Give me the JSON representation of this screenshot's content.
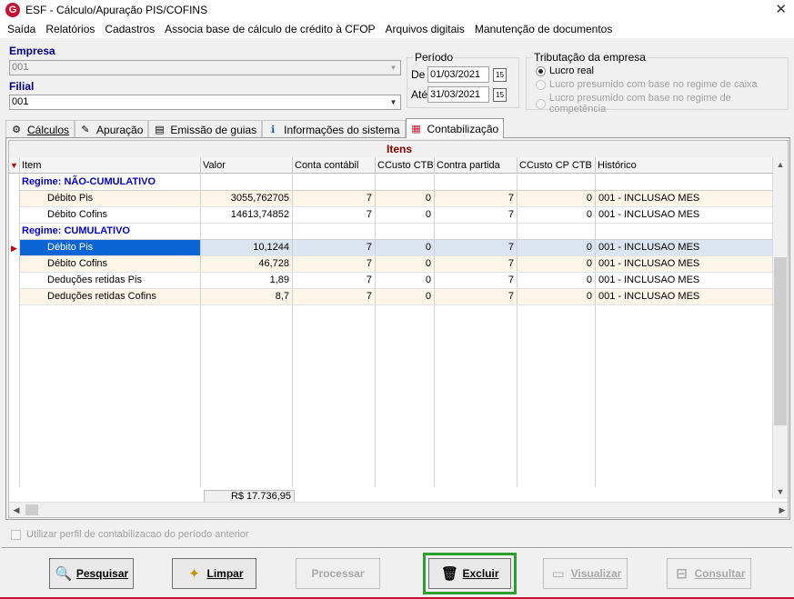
{
  "window": {
    "title": "ESF - Cálculo/Apuração PIS/COFINS",
    "logo_letter": "G",
    "close_glyph": "✕"
  },
  "menu": [
    "Saída",
    "Relatórios",
    "Cadastros",
    "Associa base de cálculo de crédito à CFOP",
    "Arquivos digitais",
    "Manutenção de documentos"
  ],
  "empresa": {
    "label": "Empresa",
    "value": "001"
  },
  "filial": {
    "label": "Filial",
    "value": "001"
  },
  "periodo": {
    "label": "Período",
    "de_label": "De",
    "de_value": "01/03/2021",
    "ate_label": "Até",
    "ate_value": "31/03/2021",
    "cal_glyph": "15"
  },
  "tributacao": {
    "label": "Tributação da empresa",
    "options": [
      {
        "label": "Lucro real",
        "checked": true,
        "enabled": true
      },
      {
        "label": "Lucro presumido com base no regime de caixa",
        "checked": false,
        "enabled": false
      },
      {
        "label": "Lucro presumido com base no regime de competência",
        "checked": false,
        "enabled": false
      }
    ]
  },
  "tabs": [
    {
      "label": "Cálculos",
      "icon": "calc-icon"
    },
    {
      "label": "Apuração",
      "icon": "apuracao-icon"
    },
    {
      "label": "Emissão de guias",
      "icon": "document-icon"
    },
    {
      "label": "Informações do sistema",
      "icon": "info-icon"
    },
    {
      "label": "Contabilização",
      "icon": "calendar-icon",
      "active": true
    }
  ],
  "grid": {
    "title": "Itens",
    "columns": [
      "Item",
      "Valor",
      "Conta contábil",
      "CCusto CTB",
      "Contra partida",
      "CCusto CP CTB",
      "Histórico"
    ],
    "rows": [
      {
        "type": "group",
        "item": "Regime: NÃO-CUMULATIVO"
      },
      {
        "type": "data",
        "item": "Débito Pis",
        "valor": "3055,762705",
        "conta": "7",
        "ccusto": "0",
        "contra": "7",
        "ccustocp": "0",
        "historico": "001 - INCLUSAO MES"
      },
      {
        "type": "data",
        "item": "Débito Cofins",
        "valor": "14613,74852",
        "conta": "7",
        "ccusto": "0",
        "contra": "7",
        "ccustocp": "0",
        "historico": "001 - INCLUSAO MES"
      },
      {
        "type": "group",
        "item": "Regime: CUMULATIVO"
      },
      {
        "type": "data",
        "item": "Débito Pis",
        "valor": "10,1244",
        "conta": "7",
        "ccusto": "0",
        "contra": "7",
        "ccustocp": "0",
        "historico": "001 - INCLUSAO MES",
        "selected": true
      },
      {
        "type": "data",
        "item": "Débito Cofins",
        "valor": "46,728",
        "conta": "7",
        "ccusto": "0",
        "contra": "7",
        "ccustocp": "0",
        "historico": "001 - INCLUSAO MES"
      },
      {
        "type": "data",
        "item": "Deduções retidas Pis",
        "valor": "1,89",
        "conta": "7",
        "ccusto": "0",
        "contra": "7",
        "ccustocp": "0",
        "historico": "001 - INCLUSAO MES"
      },
      {
        "type": "data",
        "item": "Deduções retidas Cofins",
        "valor": "8,7",
        "conta": "7",
        "ccusto": "0",
        "contra": "7",
        "ccustocp": "0",
        "historico": "001 - INCLUSAO MES"
      }
    ],
    "total": "R$ 17.736,95"
  },
  "checkbox_label": "Utilizar perfil de contabilizacao do período anterior",
  "buttons": {
    "pesquisar": "Pesquisar",
    "limpar": "Limpar",
    "processar": "Processar",
    "excluir": "Excluir",
    "visualizar": "Visualizar",
    "consultar": "Consultar"
  },
  "colors": {
    "accent_red": "#c8102e",
    "group_blue": "#0000cc",
    "selection_blue": "#0a64d6",
    "highlight_green": "#2aa02a",
    "grid_title": "#800000"
  }
}
